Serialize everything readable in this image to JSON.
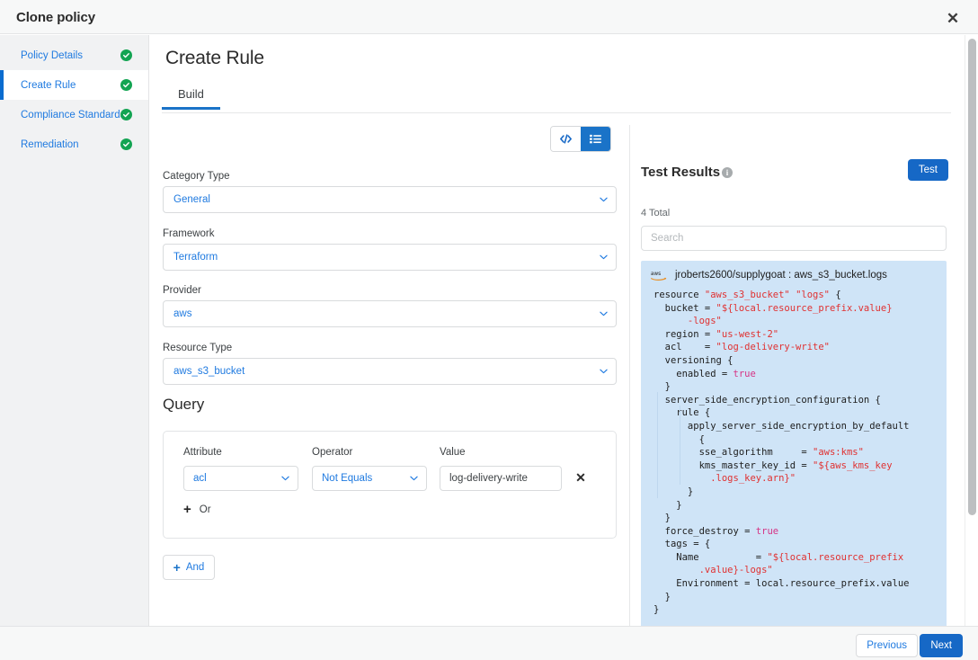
{
  "window": {
    "title": "Clone policy",
    "close_icon": "close-icon"
  },
  "sidebar": {
    "items": [
      {
        "label": "Policy Details",
        "status": "complete",
        "active": false
      },
      {
        "label": "Create Rule",
        "status": "complete",
        "active": true
      },
      {
        "label": "Compliance Standards",
        "status": "complete",
        "active": false
      },
      {
        "label": "Remediation",
        "status": "complete",
        "active": false
      }
    ]
  },
  "main": {
    "page_title": "Create Rule",
    "tabs": [
      {
        "label": "Build",
        "active": true
      }
    ]
  },
  "view_toggle": {
    "code_icon": "code-brackets-icon",
    "list_icon": "list-view-icon",
    "selected": "list"
  },
  "form": {
    "fields": [
      {
        "label": "Category Type",
        "value": "General"
      },
      {
        "label": "Framework",
        "value": "Terraform"
      },
      {
        "label": "Provider",
        "value": "aws"
      },
      {
        "label": "Resource Type",
        "value": "aws_s3_bucket"
      }
    ]
  },
  "query": {
    "title": "Query",
    "columns": {
      "attribute": "Attribute",
      "operator": "Operator",
      "value": "Value"
    },
    "row": {
      "attribute": "acl",
      "operator": "Not Equals",
      "value": "log-delivery-write",
      "remove_icon": "close-icon"
    },
    "or_label": "Or",
    "and_label": "And",
    "plus_icon": "plus-icon"
  },
  "results": {
    "title": "Test Results",
    "info_icon": "info-icon",
    "info_glyph": "i",
    "test_button": "Test",
    "total": "4 Total",
    "search_placeholder": "Search",
    "item": {
      "provider_icon": "aws-icon",
      "label": "jroberts2600/supplygoat : aws_s3_bucket.logs",
      "code": "resource \"aws_s3_bucket\" \"logs\" {\n  bucket = \"${local.resource_prefix.value}\n      -logs\"\n  region = \"us-west-2\"\n  acl    = \"log-delivery-write\"\n  versioning {\n    enabled = true\n  }\n  server_side_encryption_configuration {\n    rule {\n      apply_server_side_encryption_by_default\n        {\n        sse_algorithm     = \"aws:kms\"\n        kms_master_key_id = \"${aws_kms_key\n          .logs_key.arn}\"\n      }\n    }\n  }\n  force_destroy = true\n  tags = {\n    Name          = \"${local.resource_prefix\n        .value}-logs\"\n    Environment = local.resource_prefix.value\n  }\n}"
    }
  },
  "footer": {
    "previous": "Previous",
    "next": "Next"
  },
  "colors": {
    "accent_blue": "#1668c6",
    "link_blue": "#1f7ae0",
    "success_green": "#13a452",
    "code_bg": "#cfe4f7",
    "string_red": "#e03131",
    "bool_magenta": "#d63384"
  }
}
